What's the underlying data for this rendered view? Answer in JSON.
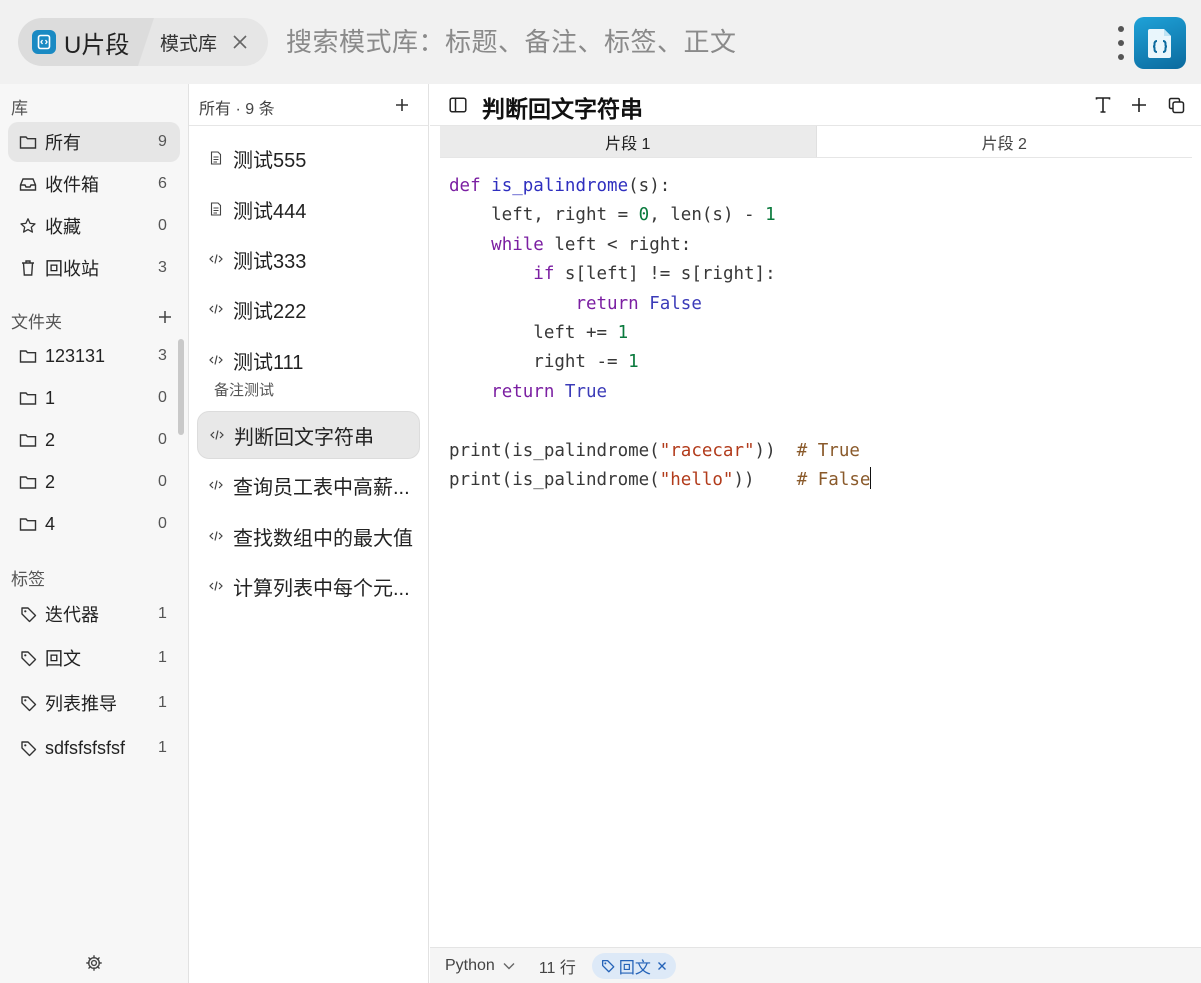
{
  "topbar": {
    "app_name": "U片段",
    "library_name": "模式库",
    "search_placeholder": "搜索模式库：标题、备注、标签、正文"
  },
  "sidebar": {
    "library_title": "库",
    "library_items": [
      {
        "label": "所有",
        "count": "9",
        "icon": "folder-icon",
        "active": true
      },
      {
        "label": "收件箱",
        "count": "6",
        "icon": "inbox-icon"
      },
      {
        "label": "收藏",
        "count": "0",
        "icon": "star-icon"
      },
      {
        "label": "回收站",
        "count": "3",
        "icon": "trash-icon"
      }
    ],
    "folders_title": "文件夹",
    "folders": [
      {
        "label": "123131",
        "count": "3"
      },
      {
        "label": "1",
        "count": "0"
      },
      {
        "label": "2",
        "count": "0"
      },
      {
        "label": "2",
        "count": "0"
      },
      {
        "label": "4",
        "count": "0"
      }
    ],
    "tags_title": "标签",
    "tags": [
      {
        "label": "迭代器",
        "count": "1"
      },
      {
        "label": "回文",
        "count": "1"
      },
      {
        "label": "列表推导",
        "count": "1"
      },
      {
        "label": "sdfsfsfsfsf",
        "count": "1"
      }
    ]
  },
  "snippet_list": {
    "header": "所有 · 9 条",
    "items": [
      {
        "title": "测试555",
        "icon": "document-icon"
      },
      {
        "title": "测试444",
        "icon": "document-icon"
      },
      {
        "title": "测试333",
        "icon": "code-icon"
      },
      {
        "title": "测试222",
        "icon": "code-icon"
      },
      {
        "title": "测试111",
        "icon": "code-icon",
        "note": "备注测试"
      },
      {
        "title": "判断回文字符串",
        "icon": "code-icon",
        "active": true
      },
      {
        "title": "查询员工表中高薪...",
        "icon": "code-icon"
      },
      {
        "title": "查找数组中的最大值",
        "icon": "code-icon"
      },
      {
        "title": "计算列表中每个元...",
        "icon": "code-icon"
      }
    ]
  },
  "editor": {
    "title": "判断回文字符串",
    "tabs": [
      "片段 1",
      "片段 2"
    ],
    "active_tab": "片段 1",
    "code_lines": [
      "def is_palindrome(s):",
      "    left, right = 0, len(s) - 1",
      "    while left < right:",
      "        if s[left] != s[right]:",
      "            return False",
      "        left += 1",
      "        right -= 1",
      "    return True",
      "",
      "print(is_palindrome(\"racecar\"))  # True",
      "print(is_palindrome(\"hello\"))    # False"
    ],
    "status": {
      "language": "Python",
      "line_count": "11 行",
      "tag": "回文"
    }
  }
}
